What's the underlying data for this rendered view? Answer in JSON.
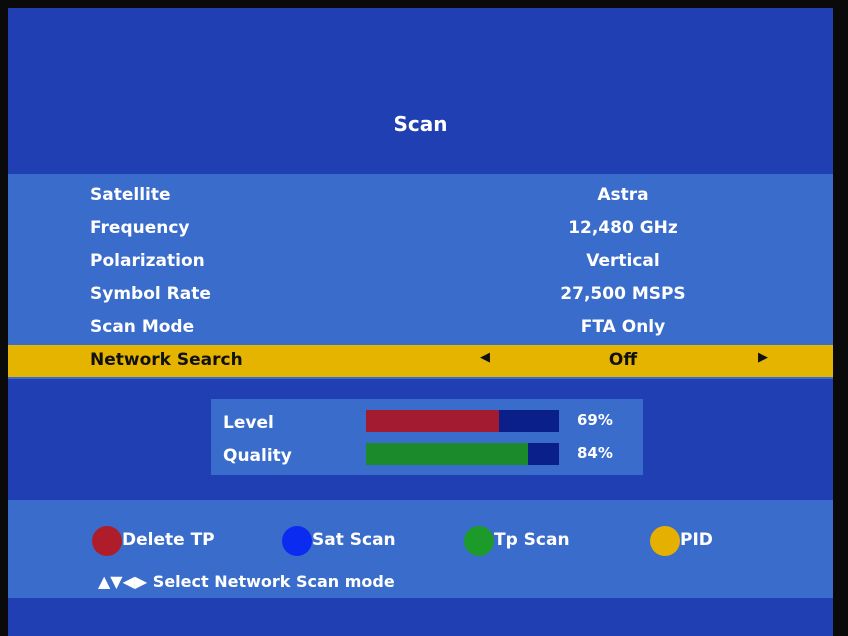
{
  "title": "Scan",
  "settings": [
    {
      "label": "Satellite",
      "value": "Astra"
    },
    {
      "label": "Frequency",
      "value": "12,480 GHz"
    },
    {
      "label": "Polarization",
      "value": "Vertical"
    },
    {
      "label": "Symbol Rate",
      "value": "27,500 MSPS"
    },
    {
      "label": "Scan Mode",
      "value": "FTA Only"
    },
    {
      "label": "Network Search",
      "value": "Off"
    }
  ],
  "selected_index": 5,
  "signal": {
    "level": {
      "label": "Level",
      "text": "69%",
      "value": 0.69,
      "color": "#a31b30"
    },
    "quality": {
      "label": "Quality",
      "text": "84%",
      "value": 0.84,
      "color": "#1b8a2a"
    }
  },
  "keys": [
    {
      "label": "Delete TP",
      "color": "#b01d2a",
      "icon": "red-key-icon"
    },
    {
      "label": "Sat Scan",
      "color": "#0b2cf0",
      "icon": "blue-key-icon"
    },
    {
      "label": "Tp Scan",
      "color": "#1c9a2a",
      "icon": "green-key-icon"
    },
    {
      "label": "PID",
      "color": "#e6b000",
      "icon": "yellow-key-icon"
    }
  ],
  "hint": {
    "arrows": "▲▼◀▶",
    "text": "Select Network Scan mode"
  },
  "colors": {
    "background": "#1f3fb3",
    "panel": "#3a6ccb",
    "highlight": "#e5b400"
  }
}
